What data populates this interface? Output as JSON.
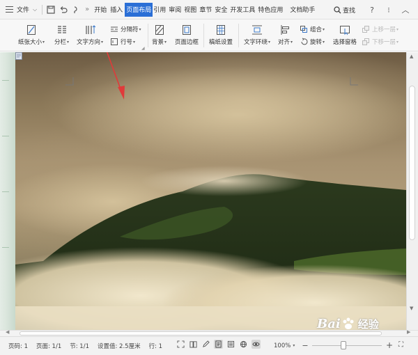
{
  "menubar": {
    "file_label": "文件",
    "tabs": [
      "开始",
      "插入",
      "页面布局",
      "引用",
      "审阅",
      "视图",
      "章节",
      "安全",
      "开发工具",
      "特色应用",
      "文档助手"
    ],
    "active_tab": "页面布局",
    "search_label": "查找",
    "help_label": "?"
  },
  "ribbon": {
    "paper_size": "纸张大小",
    "columns": "分栏",
    "text_direction": "文字方向",
    "separator": "分隔符",
    "line_number": "行号",
    "background": "背景",
    "page_border": "页面边框",
    "manuscript": "稿纸设置",
    "text_wrap": "文字环绕",
    "align": "对齐",
    "group": "组合",
    "rotate": "旋转",
    "selection_pane": "选择窗格",
    "bring_forward": "上移一层",
    "send_backward": "下移一层"
  },
  "statusbar": {
    "page_num": "页码: 1",
    "pages": "页面: 1/1",
    "section": "节: 1/1",
    "setting": "设置值: 2.5厘米",
    "row": "行: 1",
    "zoom": "100%",
    "zoom_value": 0.45
  },
  "watermark": {
    "text1": "Bai",
    "text2": "经验"
  },
  "colors": {
    "active_tab_bg": "#2b6fd6",
    "arrow_red": "#e03a3a"
  }
}
